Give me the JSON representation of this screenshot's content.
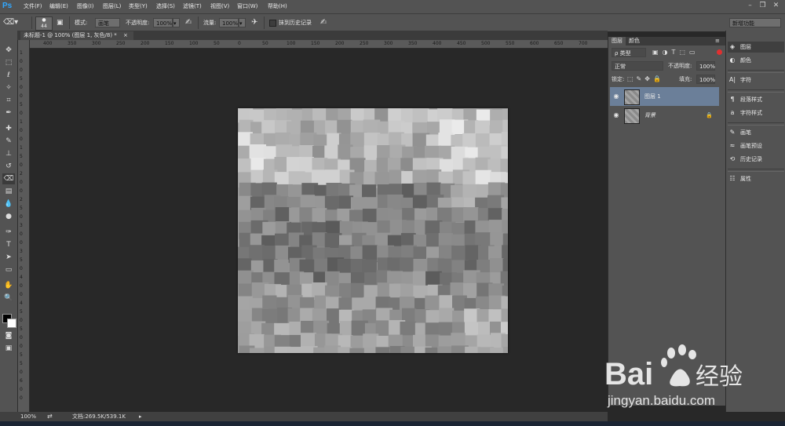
{
  "app": {
    "logo_text": "Ps"
  },
  "menu": [
    "文件(F)",
    "编辑(E)",
    "图像(I)",
    "图层(L)",
    "类型(Y)",
    "选择(S)",
    "滤镜(T)",
    "视图(V)",
    "窗口(W)",
    "帮助(H)"
  ],
  "window_controls": [
    "–",
    "❐",
    "✕"
  ],
  "options_bar": {
    "brush_size": "44",
    "mode_label": "模式:",
    "mode_value": "画笔",
    "opacity_label": "不透明度:",
    "opacity_value": "100%",
    "flow_label": "流量:",
    "flow_value": "100%",
    "erase_history_label": "抹到历史记录",
    "workspace": "新增功能"
  },
  "document": {
    "tab_title": "未标题-1 @ 100% (图层 1, 灰色/8) *",
    "close_label": "×"
  },
  "rulers": {
    "h_ticks": [
      "400",
      "350",
      "300",
      "250",
      "200",
      "150",
      "100",
      "50",
      "0",
      "50",
      "100",
      "150",
      "200",
      "250",
      "300",
      "350",
      "400",
      "450",
      "500",
      "550",
      "600",
      "650",
      "700"
    ],
    "v_ticks": [
      "1",
      "0",
      "0",
      "5",
      "0",
      "0",
      "5",
      "0",
      "1",
      "0",
      "0",
      "1",
      "5",
      "0",
      "2",
      "0",
      "0",
      "2",
      "5",
      "0",
      "3",
      "0",
      "0",
      "3",
      "5",
      "0",
      "4",
      "0",
      "0",
      "4",
      "5",
      "0",
      "5",
      "0",
      "0",
      "5",
      "5",
      "0",
      "6",
      "0",
      "0"
    ]
  },
  "status": {
    "zoom": "100%",
    "doc_info": "文档:269.5K/539.1K",
    "arrow": "▸"
  },
  "layers_panel": {
    "tabs": [
      "图层",
      "颜色"
    ],
    "filter_label": "ρ 类型",
    "blend_mode": "正常",
    "opacity_label": "不透明度:",
    "opacity_value": "100%",
    "lock_label": "锁定:",
    "fill_label": "填充:",
    "fill_value": "100%",
    "layers": [
      {
        "name": "图层 1",
        "selected": true,
        "locked": false
      },
      {
        "name": "背景",
        "selected": false,
        "locked": true
      }
    ],
    "lock_glyph": "🔒"
  },
  "right_dock": {
    "groups": [
      [
        {
          "icon": "layers-icon",
          "glyph": "◈",
          "label": "图层"
        },
        {
          "icon": "color-icon",
          "glyph": "◐",
          "label": "颜色"
        }
      ],
      [
        {
          "icon": "character-icon",
          "glyph": "A|",
          "label": "字符"
        }
      ],
      [
        {
          "icon": "paragraph-style-icon",
          "glyph": "¶",
          "label": "段落样式"
        },
        {
          "icon": "character-style-icon",
          "glyph": "a",
          "label": "字符样式"
        }
      ],
      [
        {
          "icon": "brush-icon",
          "glyph": "✎",
          "label": "画笔"
        },
        {
          "icon": "brush-preset-icon",
          "glyph": "≈",
          "label": "画笔预设"
        },
        {
          "icon": "history-icon",
          "glyph": "⟲",
          "label": "历史记录"
        }
      ],
      [
        {
          "icon": "properties-icon",
          "glyph": "☷",
          "label": "属性"
        }
      ]
    ]
  },
  "watermark": {
    "brand": "Bai",
    "brand2": "经验",
    "url": "jingyan.baidu.com"
  },
  "colors": {
    "accent": "#31a8ff",
    "selected_layer": "#6b7f99",
    "canvas_bg": "#282828"
  }
}
